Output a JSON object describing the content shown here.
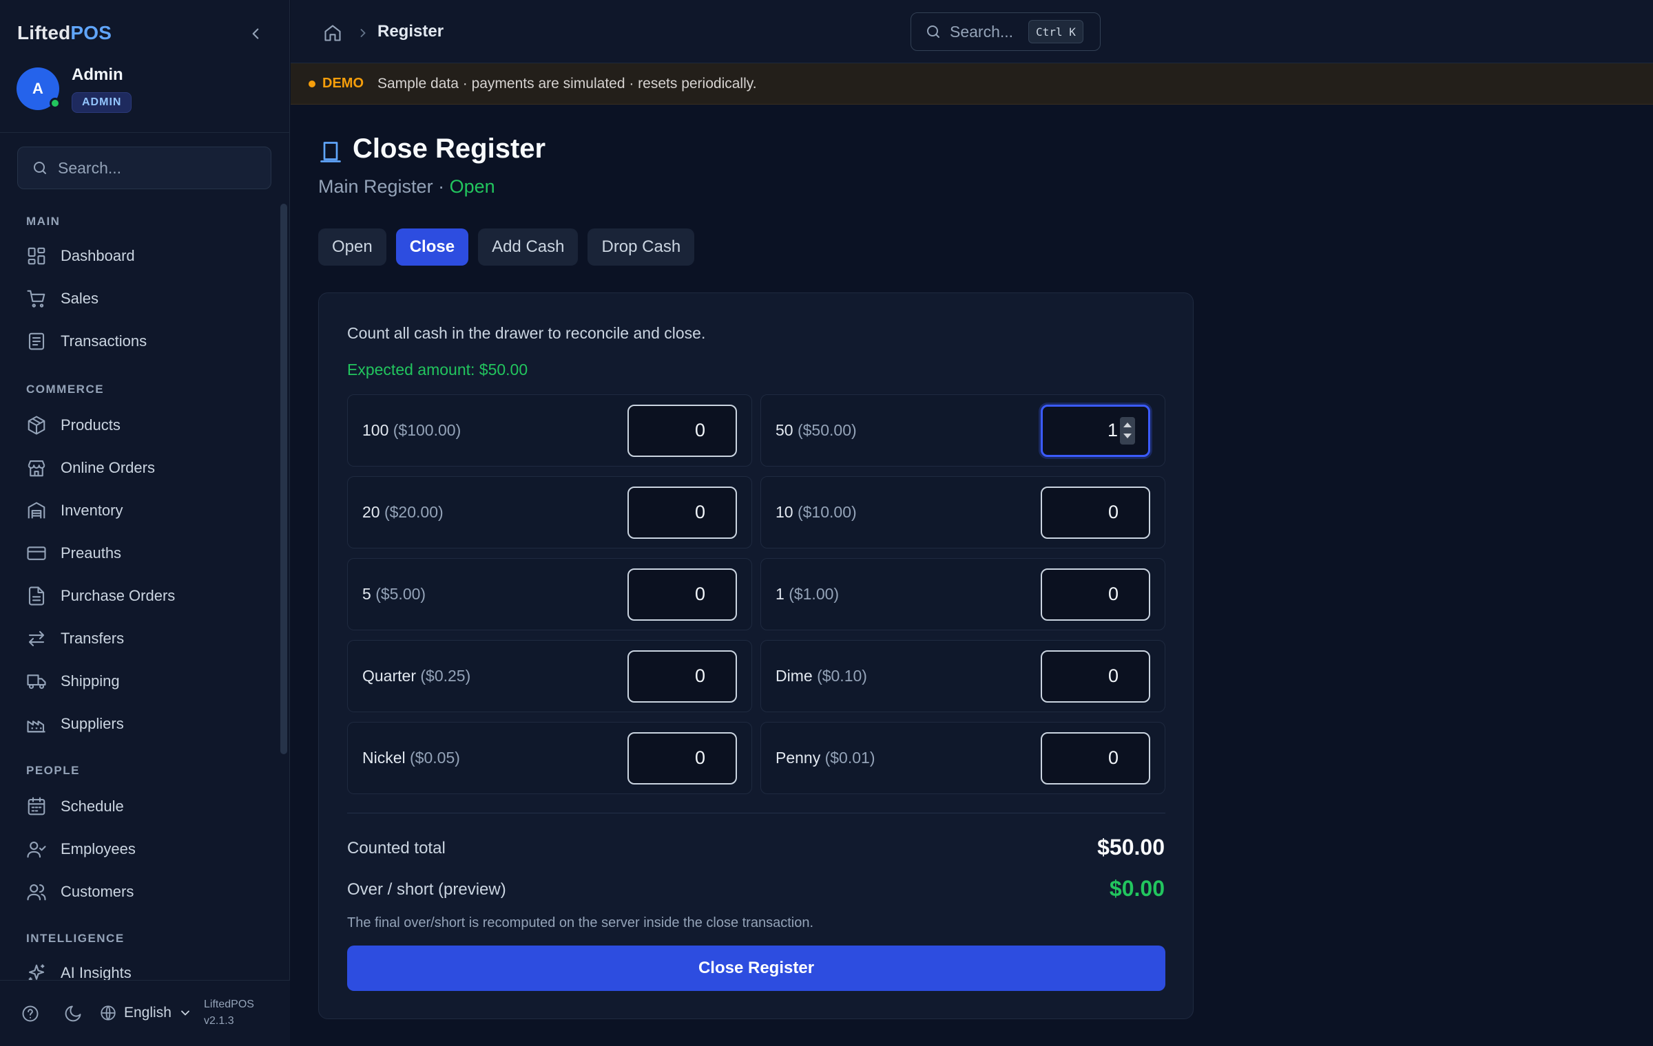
{
  "app": {
    "logo_part1": "Lifted",
    "logo_part2": "POS",
    "version_name": "LiftedPOS",
    "version_number": "v2.1.3",
    "accent_color": "#2d4de0"
  },
  "user": {
    "initial": "A",
    "name": "Admin",
    "role": "ADMIN"
  },
  "sidebar": {
    "search_placeholder": "Search...",
    "sections": {
      "main": "MAIN",
      "commerce": "COMMERCE",
      "people": "PEOPLE",
      "intelligence": "INTELLIGENCE"
    },
    "items": {
      "dashboard": "Dashboard",
      "sales": "Sales",
      "transactions": "Transactions",
      "products": "Products",
      "online_orders": "Online Orders",
      "inventory": "Inventory",
      "preauths": "Preauths",
      "purchase_orders": "Purchase Orders",
      "transfers": "Transfers",
      "shipping": "Shipping",
      "suppliers": "Suppliers",
      "schedule": "Schedule",
      "employees": "Employees",
      "customers": "Customers",
      "ai_insights": "AI Insights"
    },
    "footer": {
      "language": "English"
    }
  },
  "header": {
    "breadcrumb_current": "Register",
    "search_placeholder": "Search...",
    "search_shortcut": "Ctrl K"
  },
  "banner": {
    "tag": "DEMO",
    "text": "Sample data · payments are simulated · resets periodically."
  },
  "page": {
    "title": "Close Register",
    "register_name": "Main Register · ",
    "register_status": "Open",
    "tabs": {
      "open": "Open",
      "close": "Close",
      "add_cash": "Add Cash",
      "drop_cash": "Drop Cash"
    },
    "instruction": "Count all cash in the drawer to reconcile and close.",
    "expected_amount": "Expected amount: $50.00",
    "denominations": [
      {
        "label": "100",
        "amount": "($100.00)",
        "count": "0"
      },
      {
        "label": "50",
        "amount": "($50.00)",
        "count": "1"
      },
      {
        "label": "20",
        "amount": "($20.00)",
        "count": "0"
      },
      {
        "label": "10",
        "amount": "($10.00)",
        "count": "0"
      },
      {
        "label": "5",
        "amount": "($5.00)",
        "count": "0"
      },
      {
        "label": "1",
        "amount": "($1.00)",
        "count": "0"
      },
      {
        "label": "Quarter",
        "amount": "($0.25)",
        "count": "0"
      },
      {
        "label": "Dime",
        "amount": "($0.10)",
        "count": "0"
      },
      {
        "label": "Nickel",
        "amount": "($0.05)",
        "count": "0"
      },
      {
        "label": "Penny",
        "amount": "($0.01)",
        "count": "0"
      }
    ],
    "counted_total_label": "Counted total",
    "counted_total_value": "$50.00",
    "over_short_label": "Over / short (preview)",
    "over_short_value": "$0.00",
    "over_short_color": "#22c55e",
    "note": "The final over/short is recomputed on the server inside the close transaction.",
    "close_button": "Close Register"
  }
}
